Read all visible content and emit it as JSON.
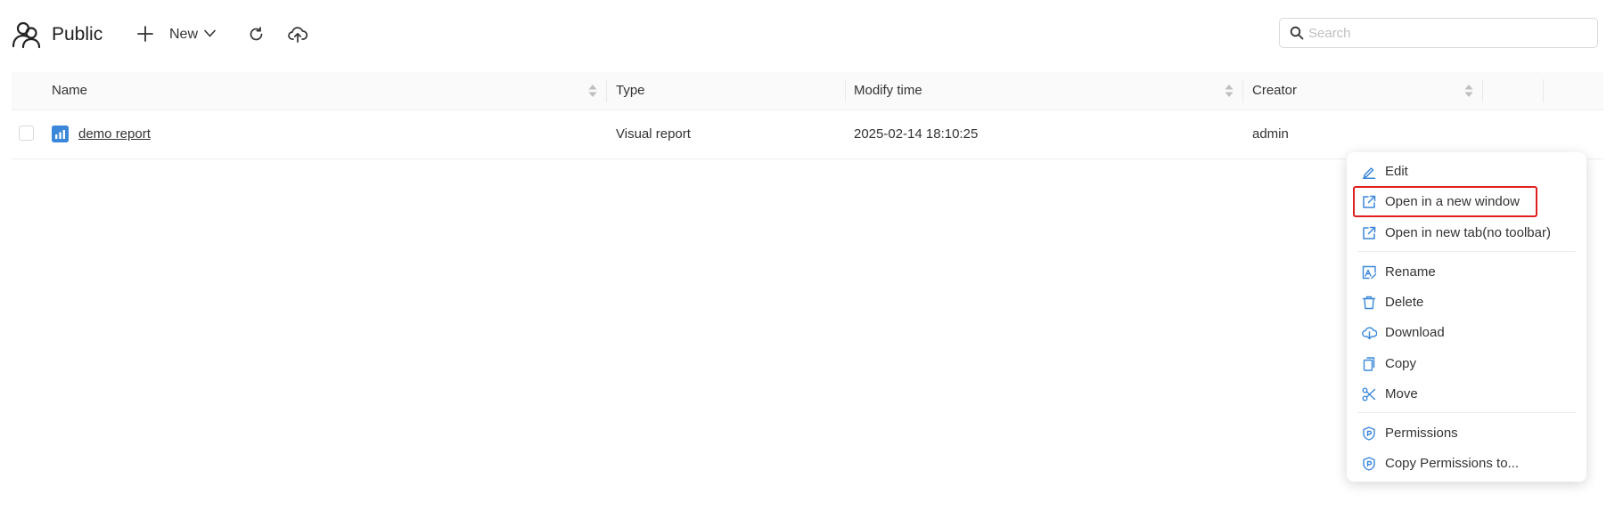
{
  "header": {
    "title": "Public",
    "new_label": "New",
    "search_placeholder": "Search"
  },
  "table": {
    "columns": [
      "Name",
      "Type",
      "Modify time",
      "Creator"
    ],
    "rows": [
      {
        "name": "demo report",
        "type": "Visual report",
        "modify_time": "2025-02-14 18:10:25",
        "creator": "admin"
      }
    ]
  },
  "context_menu": {
    "highlighted_item": "Open in a new window",
    "highlight_color": "#e02020",
    "icon_color": "#3b87d9",
    "items": [
      {
        "label": "Edit",
        "icon": "edit-icon"
      },
      {
        "label": "Open in a new window",
        "icon": "external-link-icon"
      },
      {
        "label": "Open in new tab(no toolbar)",
        "icon": "external-link-icon"
      },
      {
        "label": "Rename",
        "icon": "rename-icon"
      },
      {
        "label": "Delete",
        "icon": "trash-icon"
      },
      {
        "label": "Download",
        "icon": "cloud-download-icon"
      },
      {
        "label": "Copy",
        "icon": "copy-icon"
      },
      {
        "label": "Move",
        "icon": "scissors-icon"
      },
      {
        "label": "Permissions",
        "icon": "shield-icon"
      },
      {
        "label": "Copy Permissions to...",
        "icon": "shield-icon"
      }
    ]
  }
}
